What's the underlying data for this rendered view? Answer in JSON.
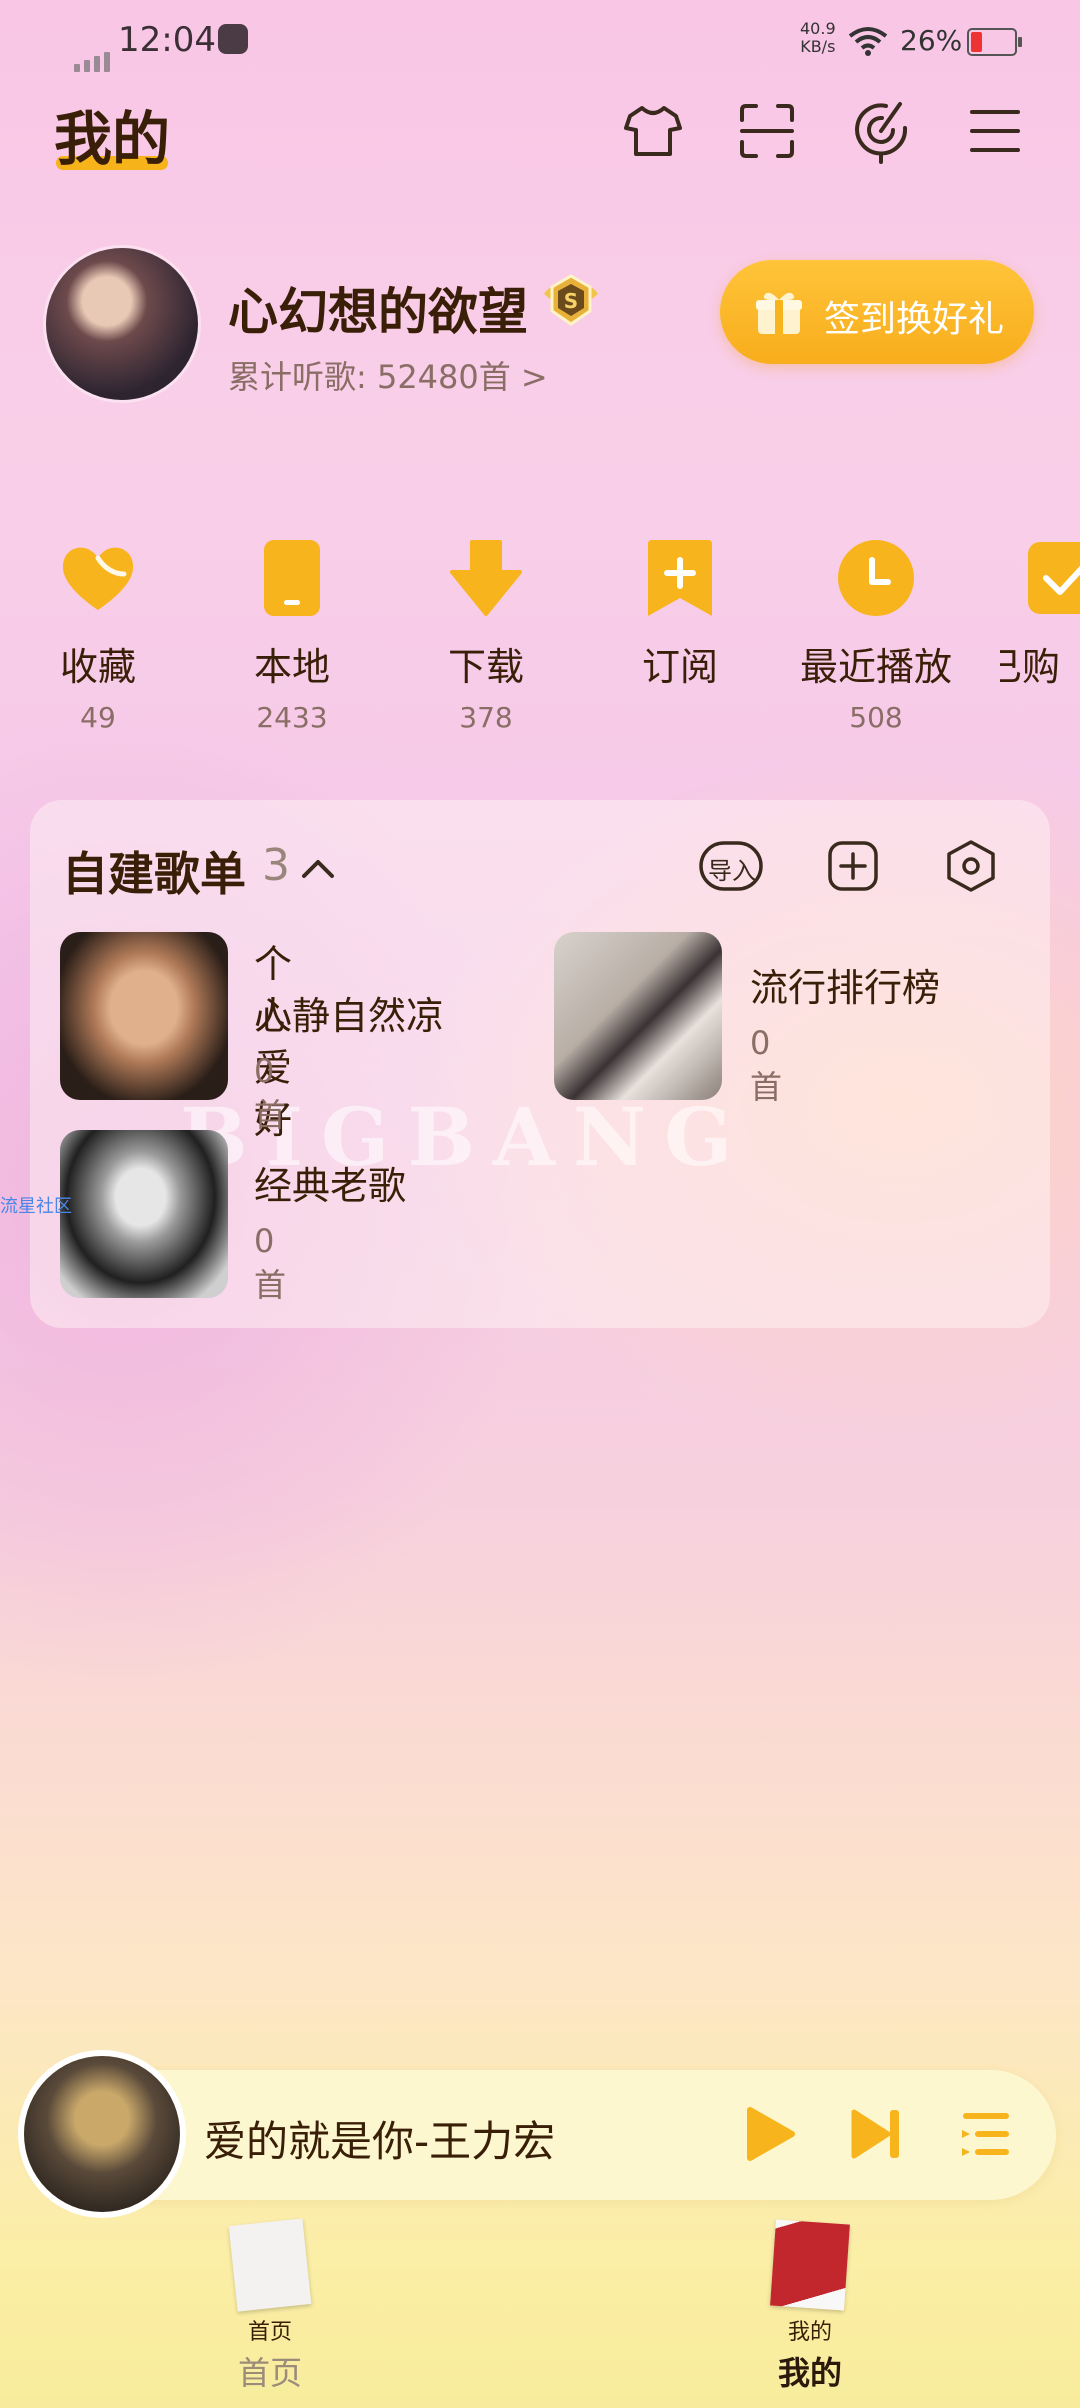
{
  "status_bar": {
    "time": "12:04",
    "net_speed": "40.9",
    "net_unit": "KB/s",
    "battery": "26%"
  },
  "header": {
    "title": "我的",
    "icons": [
      "tshirt-icon",
      "scan-icon",
      "radar-icon",
      "menu-icon"
    ]
  },
  "profile": {
    "username": "心幻想的欲望",
    "vip_level": "S",
    "listen_count": "累计听歌: 52480首 >",
    "signin_label": "签到换好礼"
  },
  "quick_actions": [
    {
      "label": "收藏",
      "count": "49",
      "icon": "heart-icon"
    },
    {
      "label": "本地",
      "count": "2433",
      "icon": "phone-icon"
    },
    {
      "label": "下载",
      "count": "378",
      "icon": "download-icon"
    },
    {
      "label": "订阅",
      "count": "",
      "icon": "subscribe-icon"
    },
    {
      "label": "最近播放",
      "count": "508",
      "icon": "clock-icon"
    },
    {
      "label": "已购",
      "count": "",
      "icon": "purchased-icon"
    }
  ],
  "playlists": {
    "title": "自建歌单",
    "count": "3",
    "import_label": "导入",
    "items": [
      {
        "name_line1": "个人爱好",
        "name_line2": "心静自然凉",
        "count": "0首"
      },
      {
        "name_line1": "流行排行榜",
        "name_line2": "",
        "count": "0首"
      },
      {
        "name_line1": "经典老歌",
        "name_line2": "",
        "count": "0首"
      }
    ],
    "watermark": "BIGBANG",
    "side_link": "流星社区"
  },
  "player": {
    "now_playing": "爱的就是你-王力宏"
  },
  "bottom_nav": [
    {
      "small": "首页",
      "label": "首页",
      "active": false
    },
    {
      "small": "我的",
      "label": "我的",
      "active": true
    }
  ],
  "colors": {
    "accent": "#f8b41c",
    "text": "#3a1f08"
  }
}
